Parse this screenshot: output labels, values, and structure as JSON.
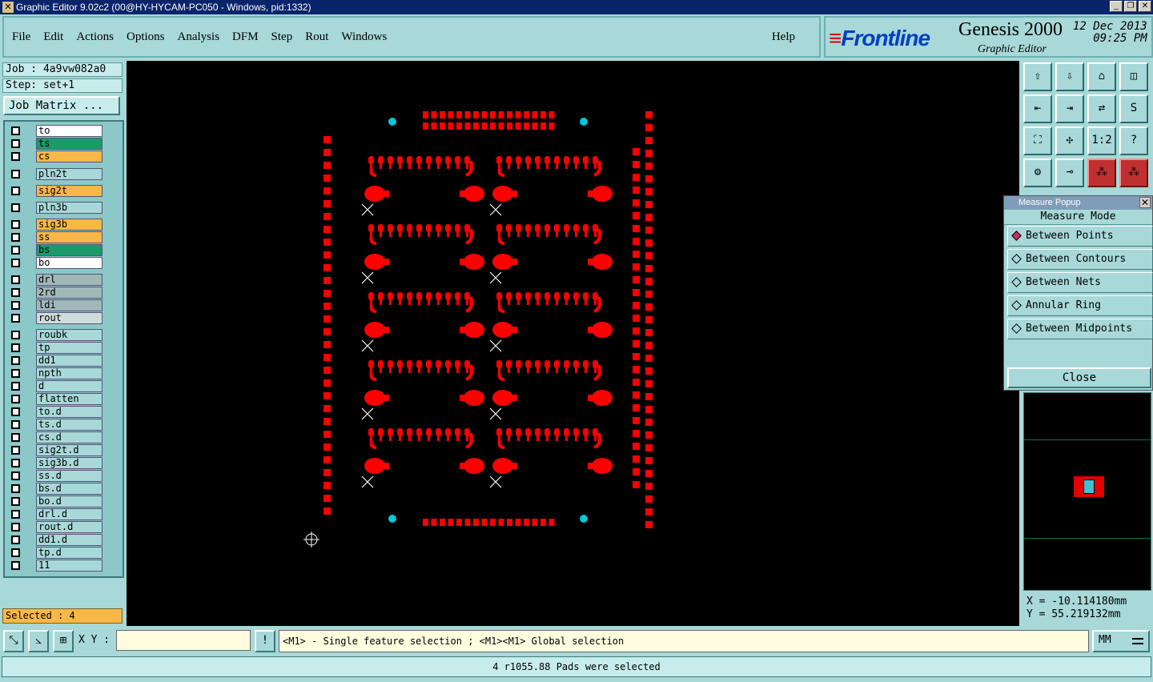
{
  "window": {
    "title": "Graphic Editor 9.02c2 (00@HY-HYCAM-PC050 - Windows, pid:1332)"
  },
  "menu": {
    "items": [
      "File",
      "Edit",
      "Actions",
      "Options",
      "Analysis",
      "DFM",
      "Step",
      "Rout",
      "Windows"
    ],
    "help": "Help"
  },
  "brand": {
    "logo": "Frontline",
    "product": "Genesis 2000",
    "subtitle": "Graphic Editor",
    "date": "12 Dec 2013",
    "time": "09:25 PM"
  },
  "job": {
    "job": "Job : 4a9vw082a0",
    "step": "Step: set+1",
    "matrix_button": "Job Matrix ..."
  },
  "layers": [
    {
      "name": "to",
      "color": "#ffffff"
    },
    {
      "name": "ts",
      "color": "#1a9a6a"
    },
    {
      "name": "cs",
      "color": "#f8b848"
    },
    {
      "name": "pln2t",
      "color": "#a8d8d8"
    },
    {
      "name": "sig2t",
      "color": "#f8b848"
    },
    {
      "name": "pln3b",
      "color": "#a8d8d8"
    },
    {
      "name": "sig3b",
      "color": "#f8b848"
    },
    {
      "name": "ss",
      "color": "#f8b848"
    },
    {
      "name": "bs",
      "color": "#1a9a6a"
    },
    {
      "name": "bo",
      "color": "#ffffff"
    },
    {
      "name": "drl",
      "color": "#a0b8b8"
    },
    {
      "name": "2rd",
      "color": "#a0b8b8"
    },
    {
      "name": "ldi",
      "color": "#a0b8b8"
    },
    {
      "name": "rout",
      "color": "#d0dcdc"
    },
    {
      "name": "roubk",
      "color": "#a8d8d8"
    },
    {
      "name": "tp",
      "color": "#a8d8d8"
    },
    {
      "name": "dd1",
      "color": "#a8d8d8"
    },
    {
      "name": "npth",
      "color": "#a8d8d8"
    },
    {
      "name": "d",
      "color": "#a8d8d8"
    },
    {
      "name": "flatten",
      "color": "#a8d8d8"
    },
    {
      "name": "to.d",
      "color": "#a8d8d8"
    },
    {
      "name": "ts.d",
      "color": "#a8d8d8"
    },
    {
      "name": "cs.d",
      "color": "#a8d8d8"
    },
    {
      "name": "sig2t.d",
      "color": "#a8d8d8"
    },
    {
      "name": "sig3b.d",
      "color": "#a8d8d8"
    },
    {
      "name": "ss.d",
      "color": "#a8d8d8"
    },
    {
      "name": "bs.d",
      "color": "#a8d8d8"
    },
    {
      "name": "bo.d",
      "color": "#a8d8d8"
    },
    {
      "name": "drl.d",
      "color": "#a8d8d8"
    },
    {
      "name": "rout.d",
      "color": "#a8d8d8"
    },
    {
      "name": "dd1.d",
      "color": "#a8d8d8"
    },
    {
      "name": "tp.d",
      "color": "#a8d8d8"
    },
    {
      "name": "11",
      "color": "#a8d8d8"
    }
  ],
  "selected_count": "Selected : 4",
  "toolbar_icons": [
    "zoom-home-icon",
    "zoom-step-icon",
    "home-icon",
    "window-icon",
    "pan-left-icon",
    "pan-right-icon",
    "swap-icon",
    "snap-icon",
    "fit-icon",
    "center-icon",
    "ratio-icon",
    "help-icon",
    "tools-icon",
    "probe-icon",
    "net-icon",
    "netlist-icon"
  ],
  "toolbar_ratio_label": "1:2",
  "toolbar_help_label": "?",
  "measure": {
    "title": "Measure Popup",
    "mode_label": "Measure Mode",
    "options": [
      "Between Points",
      "Between Contours",
      "Between Nets",
      "Annular Ring",
      "Between Midpoints"
    ],
    "selected": "Between Points",
    "close": "Close"
  },
  "coords": {
    "x": "X = -10.114180mm",
    "y": "Y = 55.219132mm"
  },
  "input": {
    "xy_label": "X Y :",
    "value": ""
  },
  "hint": "<M1> - Single feature selection ; <M1><M1> Global selection",
  "units": "MM",
  "status": "4 r1055.88 Pads were selected",
  "colors": {
    "feature": "#ff0000",
    "fiducial": "#00c8d8",
    "canvas": "#000000"
  }
}
